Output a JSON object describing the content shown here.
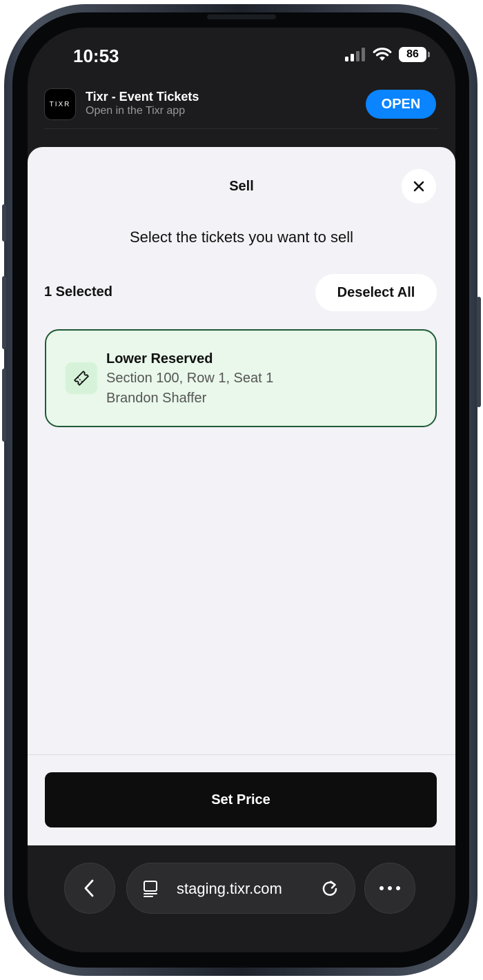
{
  "status_bar": {
    "time": "10:53",
    "battery": "86"
  },
  "app_banner": {
    "logo_text": "TIXR",
    "title": "Tixr - Event Tickets",
    "subtitle": "Open in the Tixr app",
    "open_label": "OPEN"
  },
  "sheet": {
    "title": "Sell",
    "subtitle": "Select the tickets you want to sell",
    "selected_count": "1 Selected",
    "deselect_label": "Deselect All",
    "tickets": [
      {
        "name": "Lower Reserved",
        "seat": "Section 100, Row 1, Seat 1",
        "holder": "Brandon Shaffer",
        "selected": true
      }
    ],
    "primary_button": "Set Price"
  },
  "browser": {
    "url": "staging.tixr.com"
  },
  "icons": {
    "close": "close-icon",
    "ticket": "ticket-icon",
    "back": "chevron-left-icon",
    "reader": "reader-icon",
    "reload": "reload-icon",
    "more": "more-icon"
  },
  "colors": {
    "accent_blue": "#0a84ff",
    "selected_border": "#1f5a34",
    "selected_background": "#e9f8ea",
    "primary_button": "#0d0d0d"
  }
}
